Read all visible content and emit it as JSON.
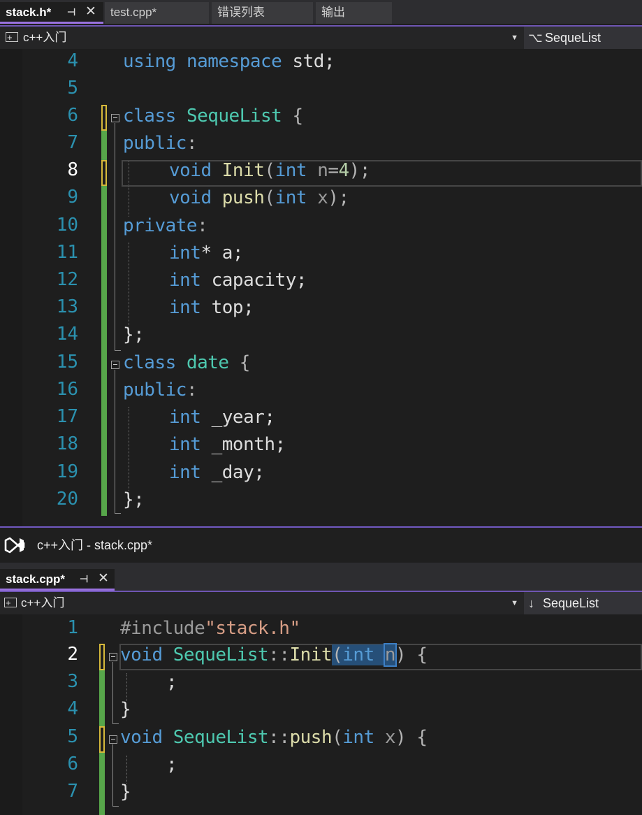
{
  "top_window": {
    "tabs": [
      {
        "label": "stack.h*",
        "active": true
      },
      {
        "label": "test.cpp*"
      },
      {
        "label": "错误列表"
      },
      {
        "label": "输出"
      }
    ],
    "tab_pin_glyph": "⊣",
    "tab_close_glyph": "✕",
    "nav_project": "c++入门",
    "nav_scope": "SequeList",
    "code_lines": [
      {
        "num": "4"
      },
      {
        "num": "5"
      },
      {
        "num": "6"
      },
      {
        "num": "7"
      },
      {
        "num": "8"
      },
      {
        "num": "9"
      },
      {
        "num": "10"
      },
      {
        "num": "11"
      },
      {
        "num": "12"
      },
      {
        "num": "13"
      },
      {
        "num": "14"
      },
      {
        "num": "15"
      },
      {
        "num": "16"
      },
      {
        "num": "17"
      },
      {
        "num": "18"
      },
      {
        "num": "19"
      },
      {
        "num": "20"
      }
    ]
  },
  "bottom_window": {
    "title": "c++入门 - stack.cpp*",
    "tab_label": "stack.cpp*",
    "tab_pin_glyph": "⊣",
    "tab_close_glyph": "✕",
    "nav_project": "c++入门",
    "nav_scope": "SequeList",
    "code_lines": [
      {
        "num": "1"
      },
      {
        "num": "2"
      },
      {
        "num": "3"
      },
      {
        "num": "4"
      },
      {
        "num": "5"
      },
      {
        "num": "6"
      },
      {
        "num": "7"
      }
    ]
  },
  "tokens": {
    "using": "using",
    "namespace": "namespace",
    "std_semi": " std;",
    "class": "class",
    "SequeList": "SequeList",
    "brace_open": " {",
    "public": "public",
    "private": "private",
    "colon": ":",
    "void": "void",
    "Init": "Init",
    "push": "push",
    "int": "int",
    "n4_a": "n",
    "eq": "=",
    "four": "4",
    "paren_close_semi": ");",
    "x": "x",
    "paren_open": "(",
    "ptr_a": "* a;",
    "capacity": " capacity;",
    "top": " top;",
    "close_brace_semi": "};",
    "date": "date",
    "year": " _year;",
    "month": " _month;",
    "day": " _day;",
    "include": "#include",
    "stack_h": "\"stack.h\"",
    "scope": "::",
    "n": "n",
    "paren_close": ")",
    "semi": ";",
    "close_brace": "}"
  },
  "colors": {
    "keyword": "#569cd6",
    "type": "#4ec9b0",
    "function": "#dcdcaa",
    "string": "#d69d85",
    "line_number": "#2b91af",
    "change_bar": "#57a64a",
    "accent": "#7159c1"
  }
}
